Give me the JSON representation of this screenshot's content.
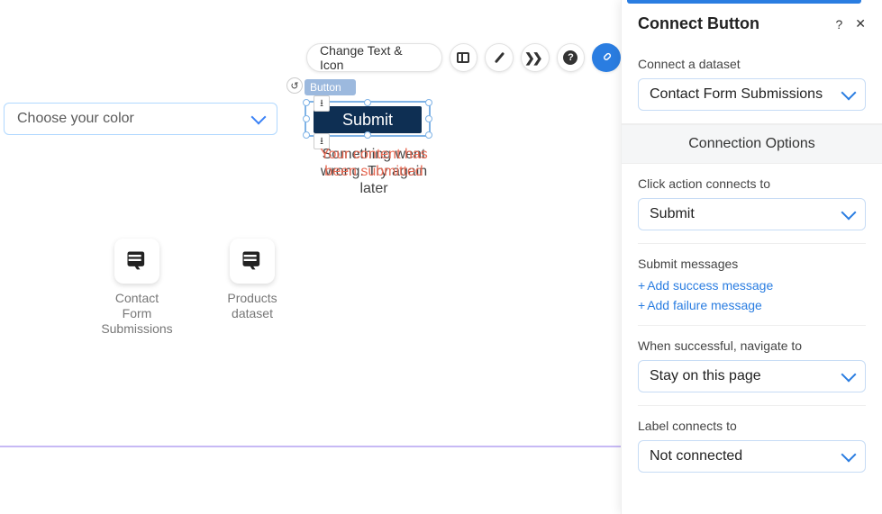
{
  "canvas": {
    "color_dropdown": {
      "placeholder": "Choose your color"
    },
    "button_element": {
      "tiny_label": "Button",
      "text": "Submit"
    },
    "status_text_bg": "Something went wrong. Try again later",
    "status_text_fg": "Your content has been submitted",
    "toolbar": {
      "change_text": "Change Text & Icon"
    },
    "datasets": [
      {
        "name": "Contact Form Submissions"
      },
      {
        "name": "Products dataset"
      }
    ]
  },
  "panel": {
    "title": "Connect Button",
    "help_glyph": "?",
    "close_glyph": "✕",
    "connect_dataset": {
      "label": "Connect a dataset",
      "value": "Contact Form Submissions"
    },
    "options_header": "Connection Options",
    "click_action": {
      "label": "Click action connects to",
      "value": "Submit"
    },
    "submit_messages": {
      "label": "Submit messages",
      "add_success": "Add success message",
      "add_failure": "Add failure message"
    },
    "navigate": {
      "label": "When successful, navigate to",
      "value": "Stay on this page"
    },
    "label_connects": {
      "label": "Label connects to",
      "value": "Not connected"
    }
  }
}
